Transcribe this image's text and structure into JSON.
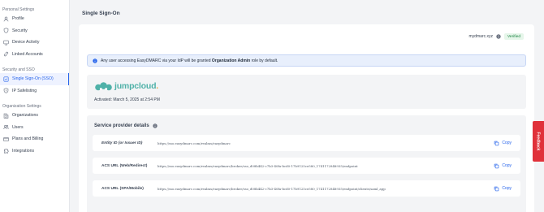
{
  "sidebar": {
    "personal_heading": "Personal Settings",
    "personal_items": [
      {
        "label": "Profile",
        "icon": "user-icon"
      },
      {
        "label": "Security",
        "icon": "shield-icon"
      },
      {
        "label": "Device Activity",
        "icon": "monitor-icon"
      },
      {
        "label": "Linked Accounts",
        "icon": "link-icon"
      }
    ],
    "sso_heading": "Security and SSO",
    "sso_items": [
      {
        "label": "Single Sign-On (SSO)",
        "icon": "shield-check-icon",
        "active": true
      },
      {
        "label": "IP Safelisting",
        "icon": "shield-ip-icon"
      }
    ],
    "org_heading": "Organization Settings",
    "org_items": [
      {
        "label": "Organizations",
        "icon": "building-icon"
      },
      {
        "label": "Users",
        "icon": "users-icon"
      },
      {
        "label": "Plans and Billing",
        "icon": "credit-card-icon"
      },
      {
        "label": "Integrations",
        "icon": "puzzle-icon"
      }
    ]
  },
  "page": {
    "title": "Single Sign-On"
  },
  "domain": {
    "name": "mydmarc.xyz",
    "status": "Verified"
  },
  "notice": {
    "prefix": "Any user accessing EasyDMARC via your IdP will be granted ",
    "role": "Organization Admin",
    "suffix": " role by default."
  },
  "provider": {
    "brand": "jumpcloud",
    "brand_dot": ".",
    "activated": "Activated: March 5, 2025 at 2:54 PM"
  },
  "service_provider": {
    "title": "Service provider details",
    "copy_label": "Copy",
    "rows": [
      {
        "label": "Entity ID (or Issuer ID)",
        "value": "https://sso.easydmarc.com/realms/easydmarc"
      },
      {
        "label": "ACS URL (Web/Redirect)",
        "value": "https://sso.easydmarc.com/realms/easydmarc/broker/sso_d08b442-c7b3-40fa-bcd0-17b9125ce580_1741172848935/endpoint"
      },
      {
        "label": "ACS URL (SPA/Mobile)",
        "value": "https://sso.easydmarc.com/realms/easydmarc/broker/sso_d08b442-c7b3-40fa-bcd0-17b9125ce580_1741172848935/endpoint/clients/saml_app"
      }
    ]
  },
  "feedback": {
    "label": "Feedback"
  },
  "colors": {
    "accent": "#2563eb",
    "verified_bg": "#e6f6ea",
    "feedback": "#e0313a",
    "brand": "#4fb1a8"
  }
}
